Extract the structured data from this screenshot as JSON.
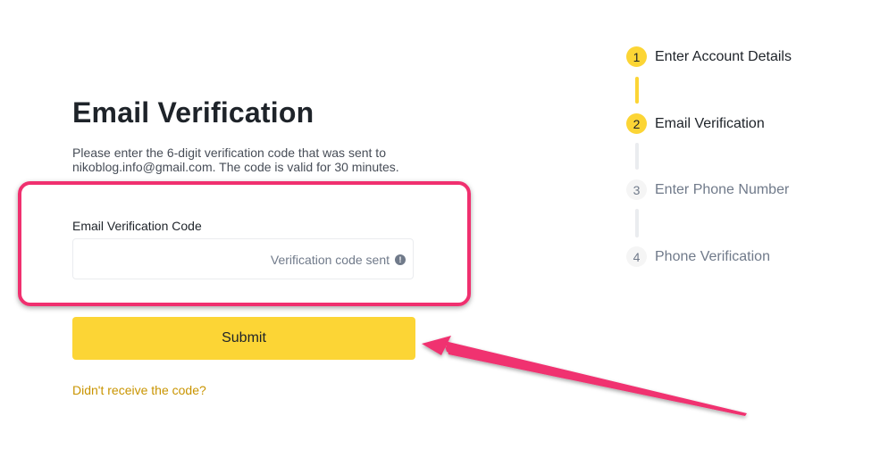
{
  "page": {
    "title": "Email Verification",
    "description": "Please enter the 6-digit verification code that was sent to nikoblog.info@gmail.com. The code is valid for 30 minutes."
  },
  "form": {
    "code_label": "Email Verification Code",
    "code_value": "",
    "code_placeholder": "",
    "sent_status": "Verification code sent",
    "submit_label": "Submit",
    "resend_link": "Didn't receive the code?"
  },
  "stepper": {
    "steps": [
      {
        "number": "1",
        "label": "Enter Account Details",
        "state": "active"
      },
      {
        "number": "2",
        "label": "Email Verification",
        "state": "active"
      },
      {
        "number": "3",
        "label": "Enter Phone Number",
        "state": "inactive"
      },
      {
        "number": "4",
        "label": "Phone Verification",
        "state": "inactive"
      }
    ]
  },
  "annotation": {
    "highlight_color": "#f0306f",
    "arrow_color": "#f0306f"
  },
  "icons": {
    "info": "info-icon"
  },
  "colors": {
    "accent": "#fcd535",
    "link": "#c99400",
    "text": "#1e2329",
    "muted": "#707a8a"
  }
}
